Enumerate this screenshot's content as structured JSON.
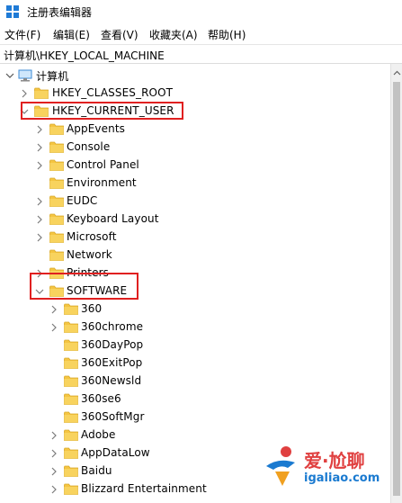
{
  "window": {
    "title": "注册表编辑器"
  },
  "menu": [
    {
      "label": "文件(F)"
    },
    {
      "label": "编辑(E)"
    },
    {
      "label": "查看(V)"
    },
    {
      "label": "收藏夹(A)"
    },
    {
      "label": "帮助(H)"
    }
  ],
  "address": {
    "path": "计算机\\HKEY_LOCAL_MACHINE"
  },
  "tree": {
    "root": {
      "label": "计算机",
      "expanded": true
    },
    "hives": [
      {
        "label": "HKEY_CLASSES_ROOT",
        "expanded": false
      },
      {
        "label": "HKEY_CURRENT_USER",
        "expanded": true,
        "highlighted": true
      }
    ],
    "hkcu_children": [
      {
        "label": "AppEvents",
        "has_children": true
      },
      {
        "label": "Console",
        "has_children": true
      },
      {
        "label": "Control Panel",
        "has_children": true
      },
      {
        "label": "Environment",
        "has_children": false
      },
      {
        "label": "EUDC",
        "has_children": true
      },
      {
        "label": "Keyboard Layout",
        "has_children": true
      },
      {
        "label": "Microsoft",
        "has_children": true
      },
      {
        "label": "Network",
        "has_children": false
      },
      {
        "label": "Printers",
        "has_children": true
      },
      {
        "label": "SOFTWARE",
        "has_children": true,
        "expanded": true,
        "highlighted": true
      }
    ],
    "software_children": [
      {
        "label": "360",
        "has_children": true
      },
      {
        "label": "360chrome",
        "has_children": true
      },
      {
        "label": "360DayPop",
        "has_children": false
      },
      {
        "label": "360ExitPop",
        "has_children": false
      },
      {
        "label": "360Newsld",
        "has_children": false
      },
      {
        "label": "360se6",
        "has_children": false
      },
      {
        "label": "360SoftMgr",
        "has_children": false
      },
      {
        "label": "Adobe",
        "has_children": true
      },
      {
        "label": "AppDataLow",
        "has_children": true
      },
      {
        "label": "Baidu",
        "has_children": true
      },
      {
        "label": "Blizzard Entertainment",
        "has_children": true
      }
    ]
  },
  "watermark": {
    "cn": "爱·尬聊",
    "en": "igaliao.com"
  },
  "colors": {
    "folder": "#f5c542",
    "highlight_border": "#e02020",
    "chevron": "#7a7a7a"
  }
}
